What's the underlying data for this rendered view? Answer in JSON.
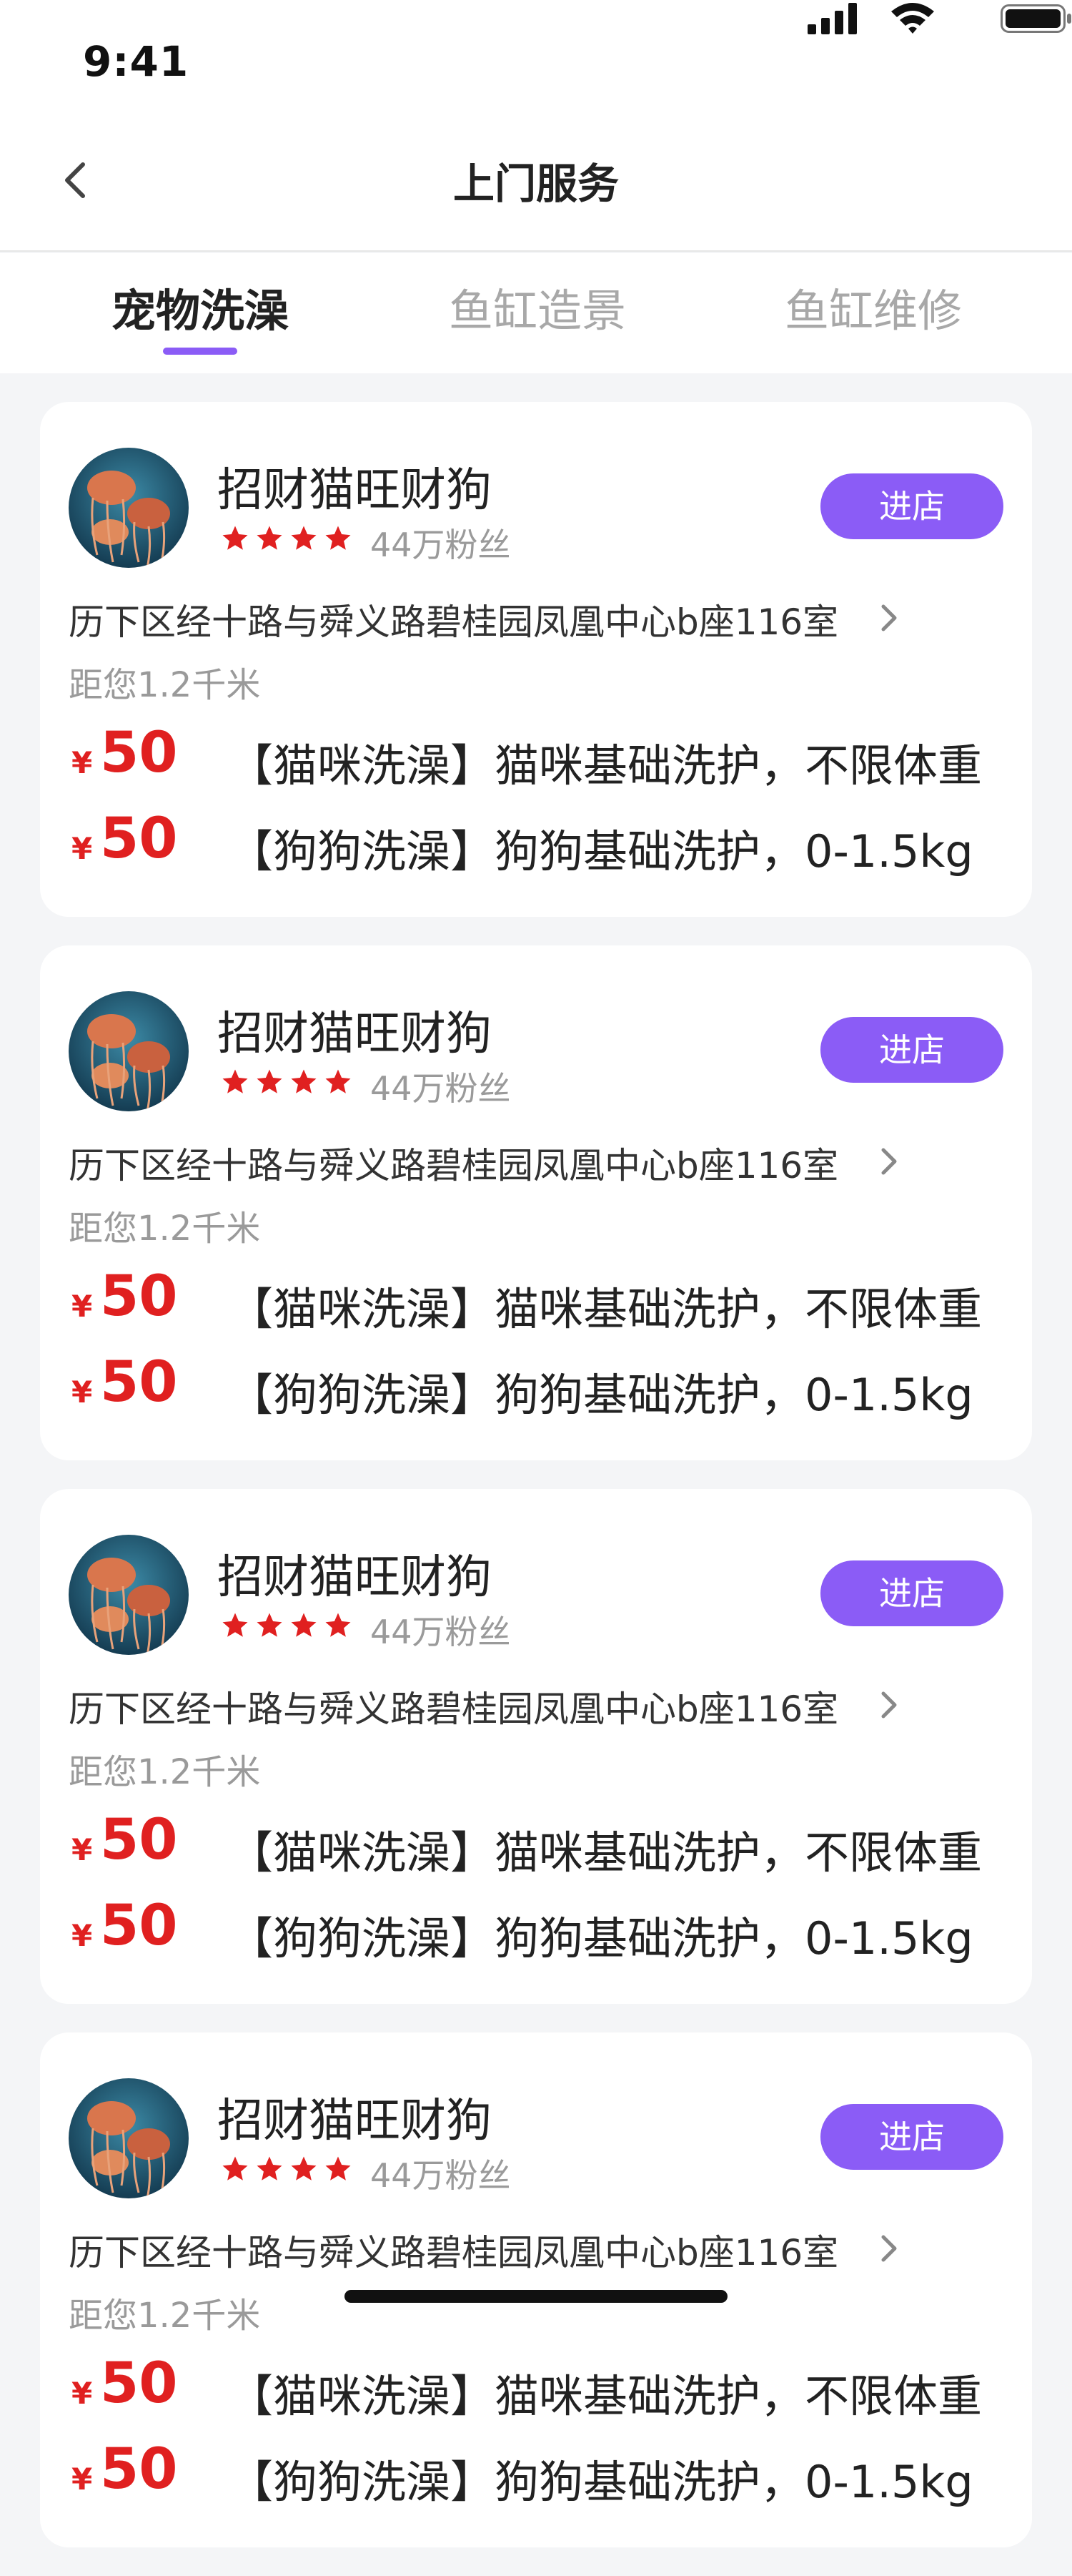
{
  "status_bar": {
    "time": "9:41"
  },
  "nav": {
    "title": "上门服务"
  },
  "tabs": [
    {
      "label": "宠物洗澡",
      "active": true
    },
    {
      "label": "鱼缸造景",
      "active": false
    },
    {
      "label": "鱼缸维修",
      "active": false
    }
  ],
  "colors": {
    "accent": "#8b5cf6",
    "price": "#e02020",
    "star": "#e02020"
  },
  "shops": [
    {
      "name": "招财猫旺财狗",
      "rating": 4,
      "fans": "44万粉丝",
      "enter_label": "进店",
      "address": "历下区经十路与舜义路碧桂园凤凰中心b座116室",
      "distance": "距您1.2千米",
      "services": [
        {
          "currency": "¥",
          "price": "50",
          "desc": "【猫咪洗澡】猫咪基础洗护，不限体重"
        },
        {
          "currency": "¥",
          "price": "50",
          "desc": "【狗狗洗澡】狗狗基础洗护，0-1.5kg"
        }
      ]
    },
    {
      "name": "招财猫旺财狗",
      "rating": 4,
      "fans": "44万粉丝",
      "enter_label": "进店",
      "address": "历下区经十路与舜义路碧桂园凤凰中心b座116室",
      "distance": "距您1.2千米",
      "services": [
        {
          "currency": "¥",
          "price": "50",
          "desc": "【猫咪洗澡】猫咪基础洗护，不限体重"
        },
        {
          "currency": "¥",
          "price": "50",
          "desc": "【狗狗洗澡】狗狗基础洗护，0-1.5kg"
        }
      ]
    },
    {
      "name": "招财猫旺财狗",
      "rating": 4,
      "fans": "44万粉丝",
      "enter_label": "进店",
      "address": "历下区经十路与舜义路碧桂园凤凰中心b座116室",
      "distance": "距您1.2千米",
      "services": [
        {
          "currency": "¥",
          "price": "50",
          "desc": "【猫咪洗澡】猫咪基础洗护，不限体重"
        },
        {
          "currency": "¥",
          "price": "50",
          "desc": "【狗狗洗澡】狗狗基础洗护，0-1.5kg"
        }
      ]
    },
    {
      "name": "招财猫旺财狗",
      "rating": 4,
      "fans": "44万粉丝",
      "enter_label": "进店",
      "address": "历下区经十路与舜义路碧桂园凤凰中心b座116室",
      "distance": "距您1.2千米",
      "services": [
        {
          "currency": "¥",
          "price": "50",
          "desc": "【猫咪洗澡】猫咪基础洗护，不限体重"
        },
        {
          "currency": "¥",
          "price": "50",
          "desc": "【狗狗洗澡】狗狗基础洗护，0-1.5kg"
        }
      ]
    }
  ],
  "icons": {
    "back": "chevron-left-icon",
    "signal": "cellular-signal-icon",
    "wifi": "wifi-icon",
    "battery": "battery-icon",
    "star": "star-icon",
    "address_arrow": "chevron-right-icon",
    "avatar": "jellyfish-avatar-image"
  }
}
